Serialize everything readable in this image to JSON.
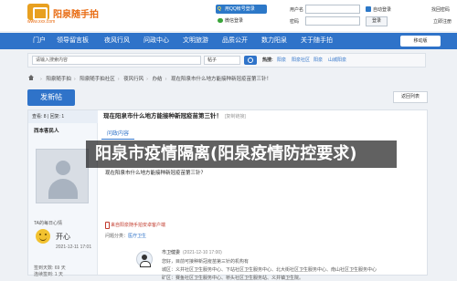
{
  "header": {
    "site_url": "www.xxx.com",
    "brand": "阳泉随手拍",
    "qq_login": "用QQ帐号登录",
    "wechat_login": "微信登录",
    "username_label": "用户名",
    "password_label": "密码",
    "auto_login": "自动登录",
    "forgot_password": "找回密码",
    "login_button": "登录",
    "register": "立即注册"
  },
  "nav": {
    "items": [
      "门户",
      "领导留言板",
      "夜风行风",
      "问政中心",
      "文明旅游",
      "品质公开",
      "数力阳泉",
      "关于随手拍"
    ],
    "mobile": "移动版"
  },
  "search": {
    "placeholder": "请输入搜索内容",
    "scope": "帖子",
    "hot_label": "热搜:",
    "hot_links": [
      "阳泉",
      "阳泉社区",
      "阳泉",
      "山城阳泉"
    ]
  },
  "breadcrumb": [
    "阳泉随手拍",
    "阳泉随手拍社区",
    "夜风行风",
    "办结",
    "现在阳泉市什么地方能接种新冠疫苗第三针！"
  ],
  "actions": {
    "post_button": "发新帖",
    "back_button": "返回列表"
  },
  "thread": {
    "stats": "查看: 8 | 回复: 1",
    "title": "现在阳泉市什么地方能接种新冠疫苗第三针！",
    "title_tag": "[复制链接]",
    "author": "西本客民人",
    "category_tab": "问政内容",
    "post_title": "现在阳泉市什么地方能接种新冠疫苗第三针？",
    "device_line": "来自阳泉随手拍安卓客户端",
    "category_label": "问题分类：",
    "category_value": "医疗卫生",
    "mood_title": "TA的每日心情",
    "mood_word": "开心",
    "mood_date": "2021-12-11 17:01",
    "author_meta": [
      "签到天数: 69 天",
      "连续签到: 1 天"
    ],
    "reply_author": "市卫健委",
    "reply_date": "(2021-12-10 17:00)",
    "reply_lines": [
      "您好，目前可接种新冠疫苗第三针的机构有",
      "城区：义井社区卫生服务中心、下站社区卫生服务中心、北大街社区卫生服务中心、南山社区卫生服务中心",
      "矿区：赛鱼社区卫生服务中心、桥头社区卫生服务站、义井镇卫生院。"
    ]
  },
  "overlay": {
    "headline": "阳泉市疫情隔离(阳泉疫情防控要求)"
  },
  "colors": {
    "nav_blue": "#2f73c9",
    "brand_orange": "#e86a10",
    "overlay_black": "#000000"
  }
}
